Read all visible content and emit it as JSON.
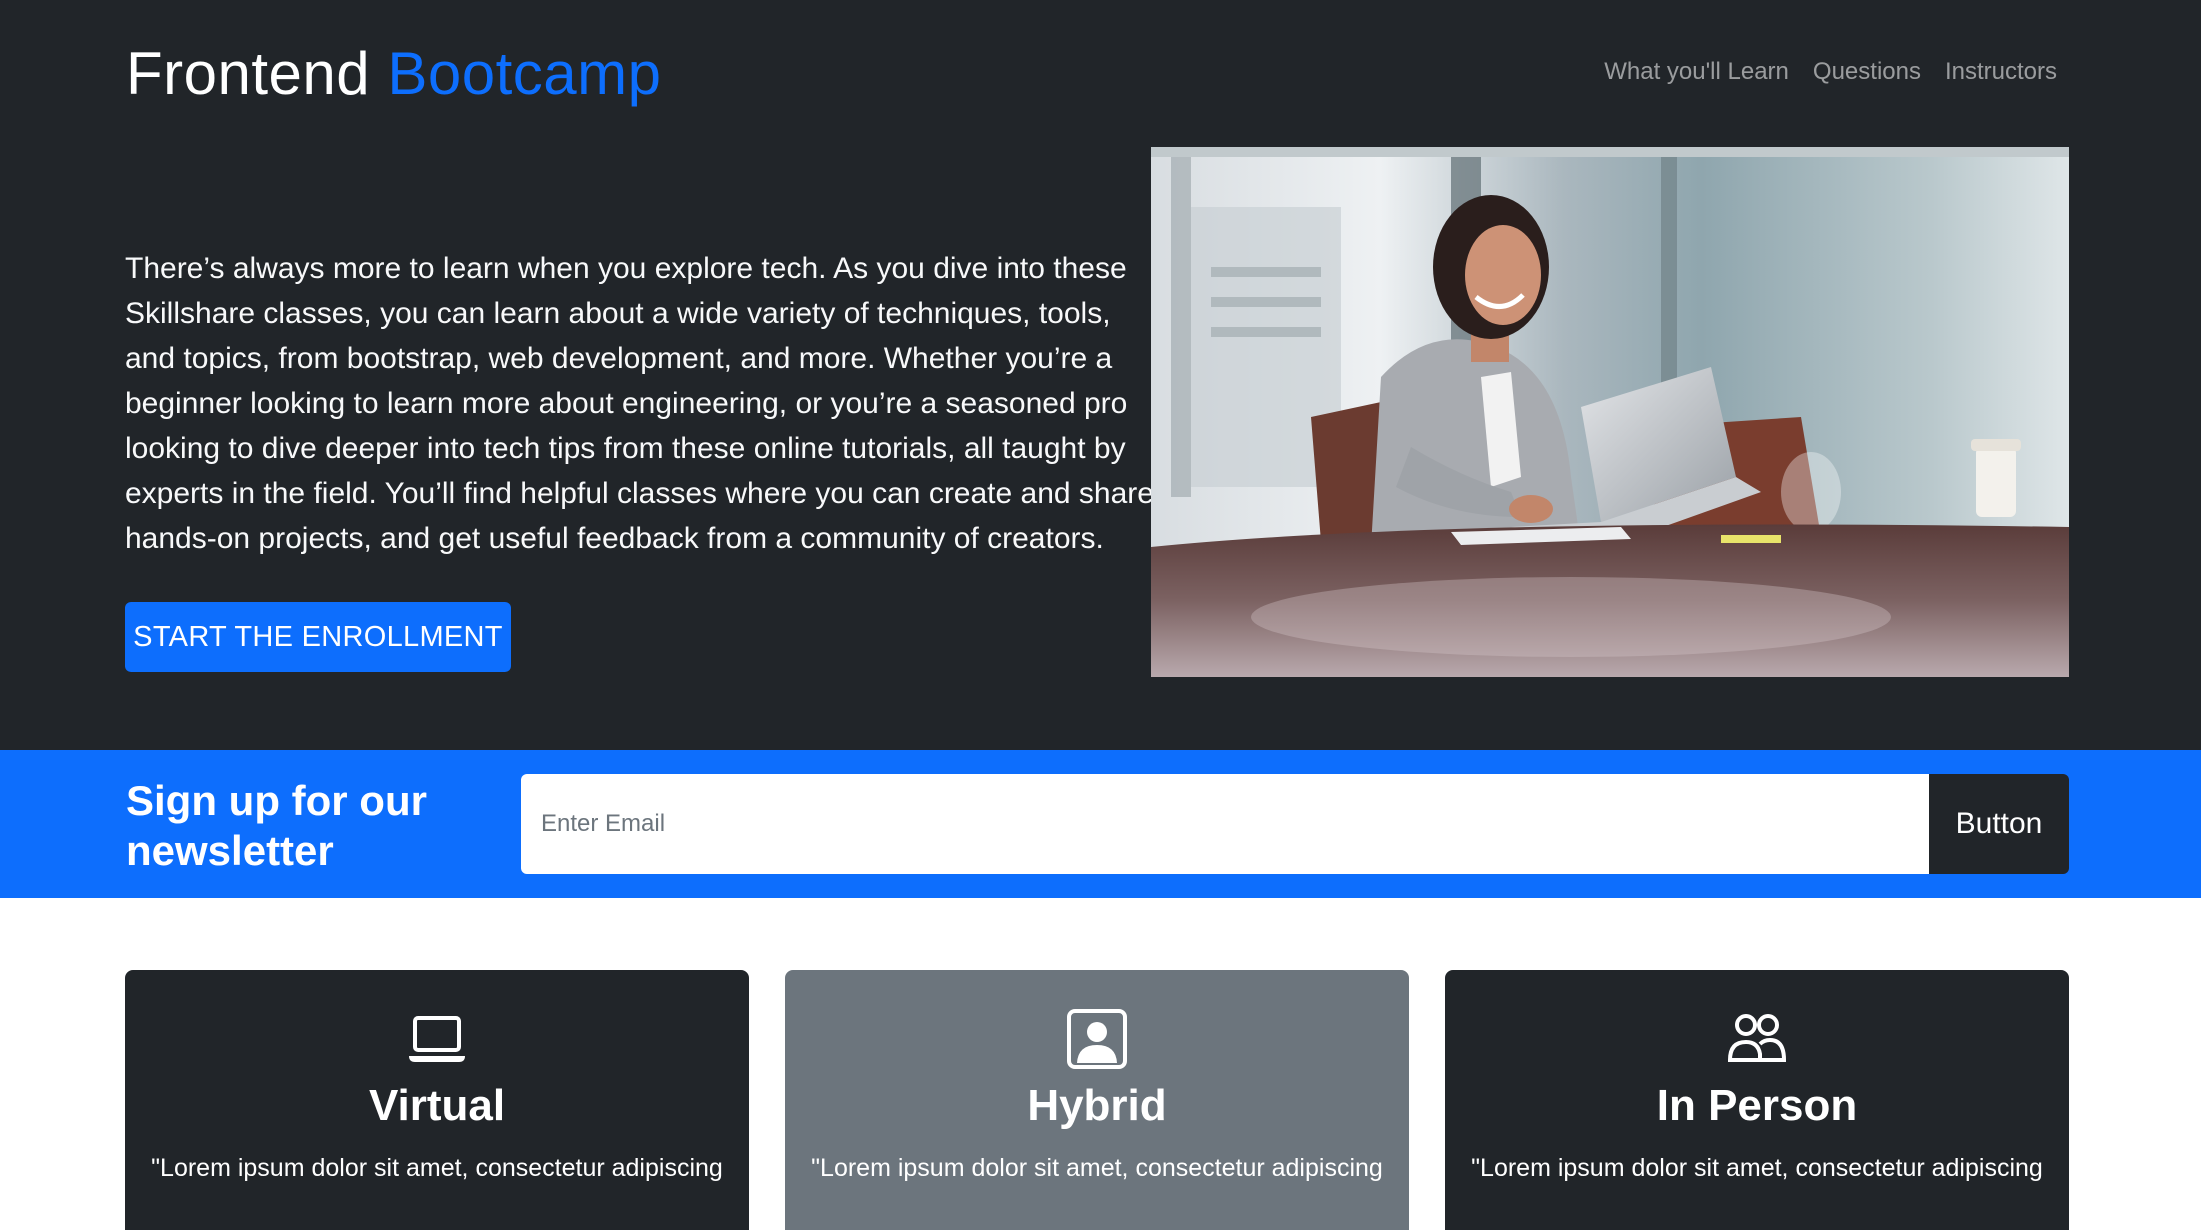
{
  "brand": {
    "primary": "Frontend",
    "accent": "Bootcamp"
  },
  "nav": {
    "items": [
      "What you'll Learn",
      "Questions",
      "Instructors"
    ]
  },
  "hero": {
    "text": "There’s always more to learn when you explore tech. As you dive into these Skillshare classes, you can learn about a wide variety of techniques, tools, and topics, from bootstrap, web development, and more. Whether you’re a beginner looking to learn more about engineering, or you’re a seasoned pro looking to dive deeper into tech tips from these online tutorials, all taught by experts in the field. You’ll find helpful classes where you can create and share hands-on projects, and get useful feedback from a community of creators.",
    "cta_label": "START THE ENROLLMENT"
  },
  "newsletter": {
    "title": "Sign up for our newsletter",
    "input_placeholder": "Enter Email",
    "button_label": "Button"
  },
  "cards": [
    {
      "title": "Virtual",
      "icon": "laptop-icon",
      "text": "\"Lorem ipsum dolor sit amet, consectetur adipiscing"
    },
    {
      "title": "Hybrid",
      "icon": "person-square-icon",
      "text": "\"Lorem ipsum dolor sit amet, consectetur adipiscing"
    },
    {
      "title": "In Person",
      "icon": "people-icon",
      "text": "\"Lorem ipsum dolor sit amet, consectetur adipiscing"
    }
  ],
  "colors": {
    "dark": "#212529",
    "primary": "#0d6efd",
    "gray": "#6c757d"
  }
}
